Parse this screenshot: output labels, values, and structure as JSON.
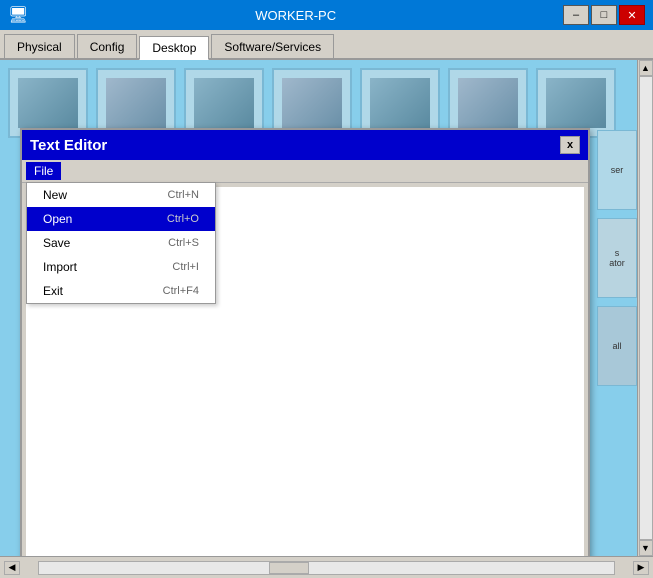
{
  "window": {
    "title": "WORKER-PC",
    "min_label": "–",
    "max_label": "□",
    "close_label": "✕"
  },
  "tabs": [
    {
      "id": "physical",
      "label": "Physical",
      "active": false
    },
    {
      "id": "config",
      "label": "Config",
      "active": false
    },
    {
      "id": "desktop",
      "label": "Desktop",
      "active": true
    },
    {
      "id": "software",
      "label": "Software/Services",
      "active": false
    }
  ],
  "editor": {
    "title": "Text Editor",
    "close_label": "x",
    "menu": {
      "file_label": "File"
    },
    "dropdown": {
      "items": [
        {
          "id": "new",
          "label": "New",
          "shortcut": "Ctrl+N",
          "highlighted": false
        },
        {
          "id": "open",
          "label": "Open",
          "shortcut": "Ctrl+O",
          "highlighted": true
        },
        {
          "id": "save",
          "label": "Save",
          "shortcut": "Ctrl+S",
          "highlighted": false
        },
        {
          "id": "import",
          "label": "Import",
          "shortcut": "Ctrl+I",
          "highlighted": false
        },
        {
          "id": "exit",
          "label": "Exit",
          "shortcut": "Ctrl+F4",
          "highlighted": false
        }
      ]
    }
  },
  "scrollbar": {
    "left_arrow": "◀",
    "right_arrow": "▶",
    "up_arrow": "▲",
    "down_arrow": "▼"
  },
  "right_panel": {
    "items": [
      {
        "id": "item1",
        "label": "ser"
      },
      {
        "id": "item2",
        "label": "s\nator"
      },
      {
        "id": "item3",
        "label": "all"
      }
    ]
  }
}
